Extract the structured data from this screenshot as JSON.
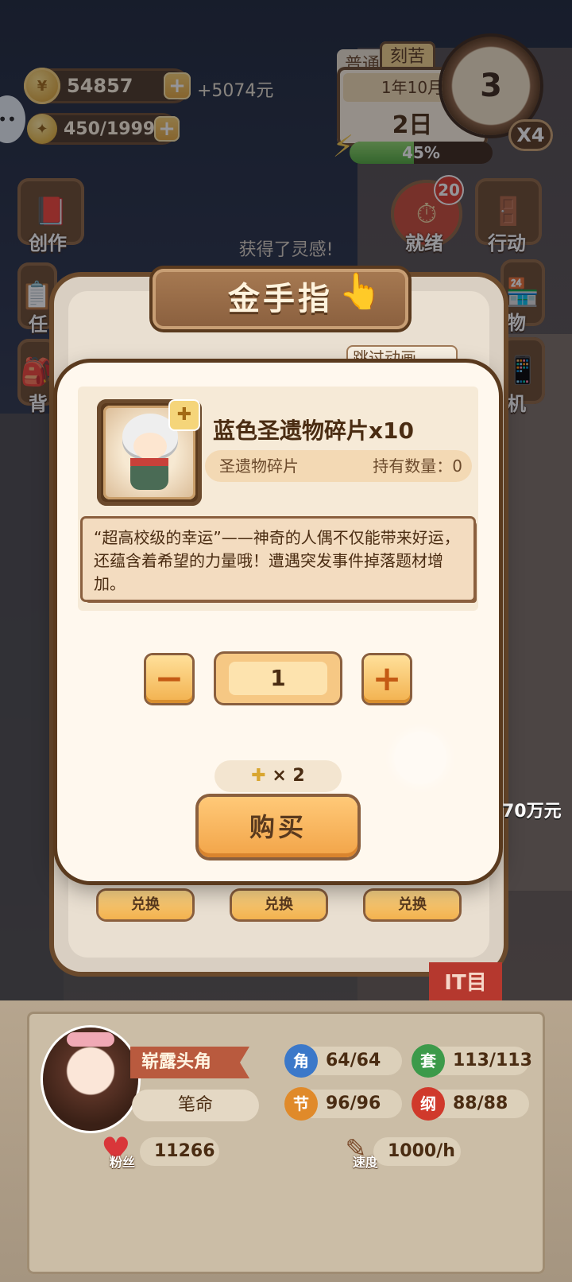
{
  "hud": {
    "coins": "54857",
    "income": "+5074元",
    "inspiration": "450/1999",
    "mode_normal": "普通",
    "mode_hard": "刻苦",
    "month": "1年10月",
    "day": "2日",
    "clock_hour": "3",
    "speed": "X4",
    "energy_percent": 45,
    "energy_label": "45%"
  },
  "side_menu": {
    "create": "创作",
    "tasks": "任",
    "bag": "背",
    "ready": "就绪",
    "ready_badge": "20",
    "action": "行动",
    "shop": "物",
    "phone": "机"
  },
  "toast": "获得了灵感!",
  "back_panel": {
    "title": "金手指",
    "skip": "跳过动画",
    "exchange_buttons": [
      "兑换",
      "兑换",
      "兑换"
    ],
    "money_label": "70万元",
    "sign": "IT目"
  },
  "modal": {
    "item_name": "蓝色圣遗物碎片x10",
    "item_type": "圣遗物碎片",
    "owned_label": "持有数量：0",
    "description": "“超高校级的幸运”——神奇的人偶不仅能带来好运，还蕴含着希望的力量哦！遭遇突发事件掉落题材增加。",
    "quantity": "1",
    "cost": "× 2",
    "buy_label": "购买"
  },
  "status": {
    "title": "崭露头角",
    "role": "笔命",
    "stats": [
      {
        "icon": "角",
        "value": "64/64",
        "color": "#3b78c9"
      },
      {
        "icon": "套",
        "value": "113/113",
        "color": "#3c9a4a"
      },
      {
        "icon": "节",
        "value": "96/96",
        "color": "#e08a2a"
      },
      {
        "icon": "纲",
        "value": "88/88",
        "color": "#d0392b"
      }
    ],
    "fans_label": "粉丝",
    "fans": "11266",
    "speed_label": "速度",
    "speed": "1000/h"
  },
  "colors": {
    "frame": "#5a3a1e",
    "accent": "#f2b14e",
    "panel": "#fff8ee"
  }
}
